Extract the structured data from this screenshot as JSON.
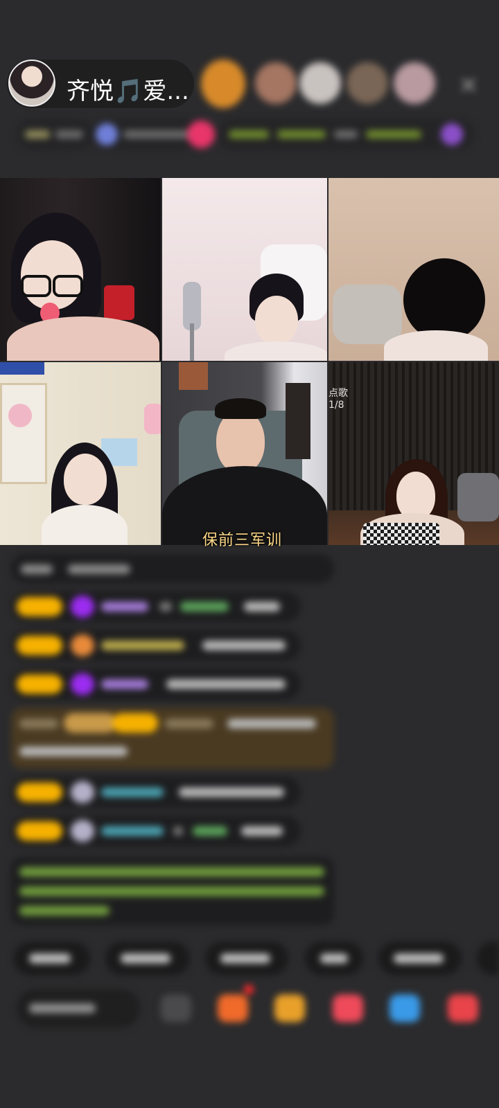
{
  "header": {
    "host_name": "齐悦🎵爱...",
    "close_symbol": "✕"
  },
  "video": {
    "caption": "保前三军训",
    "tile6_label": "1/8",
    "tile6_tag": "点歌"
  },
  "icons": {
    "avatar": "host-avatar",
    "close": "close-icon"
  },
  "colors": {
    "background": "#2b2b2d",
    "level_badge": "#f6b100",
    "caption": "#ffd98a"
  }
}
